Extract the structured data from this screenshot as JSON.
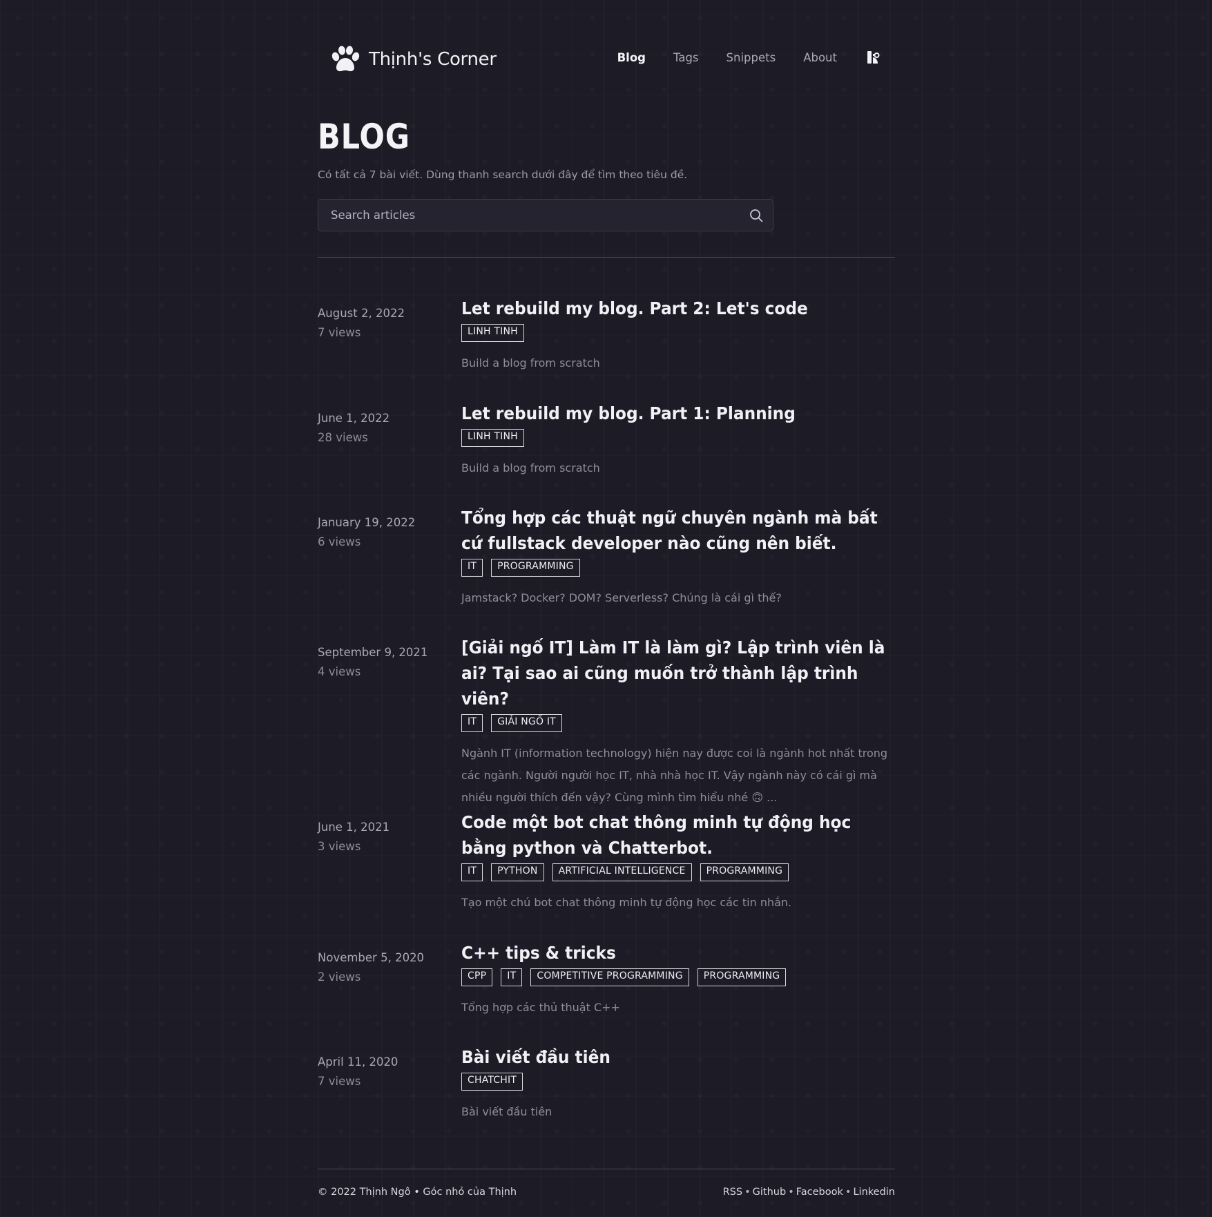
{
  "brand": {
    "name": "Thịnh's Corner"
  },
  "nav": {
    "items": [
      {
        "label": "Blog",
        "active": true
      },
      {
        "label": "Tags",
        "active": false
      },
      {
        "label": "Snippets",
        "active": false
      },
      {
        "label": "About",
        "active": false
      }
    ],
    "theme_toggle_icon": "theme-toggle-icon"
  },
  "page": {
    "title": "BLOG",
    "subtitle": "Có tất cả 7 bài viết. Dùng thanh search dưới đây để tìm theo tiêu đề."
  },
  "search": {
    "placeholder": "Search articles",
    "value": ""
  },
  "posts": [
    {
      "date": "August 2, 2022",
      "views": "7 views",
      "title": "Let rebuild my blog. Part 2: Let's code",
      "tags": [
        "LINH TINH"
      ],
      "summary": "Build a blog from scratch"
    },
    {
      "date": "June 1, 2022",
      "views": "28 views",
      "title": "Let rebuild my blog. Part 1: Planning",
      "tags": [
        "LINH TINH"
      ],
      "summary": "Build a blog from scratch"
    },
    {
      "date": "January 19, 2022",
      "views": "6 views",
      "title": "Tổng hợp các thuật ngữ chuyên ngành mà bất cứ fullstack developer nào cũng nên biết.",
      "tags": [
        "IT",
        "PROGRAMMING"
      ],
      "summary": "Jamstack? Docker? DOM? Serverless? Chúng là cái gì thế?"
    },
    {
      "date": "September 9, 2021",
      "views": "4 views",
      "title": "[Giải ngố IT] Làm IT là làm gì? Lập trình viên là ai? Tại sao ai cũng muốn trở thành lập trình viên?",
      "tags": [
        "IT",
        "GIẢI NGỐ IT"
      ],
      "summary": "Ngành IT (information technology) hiện nay được coi là ngành hot nhất trong các ngành. Người người học IT, nhà nhà học IT. Vậy ngành này có cái gì mà nhiều người thích đến vậy? Cùng mình tìm hiểu nhé 🙃 ..."
    },
    {
      "date": "June 1, 2021",
      "views": "3 views",
      "title": "Code một bot chat thông minh tự động học bằng python và Chatterbot.",
      "tags": [
        "IT",
        "PYTHON",
        "ARTIFICIAL INTELLIGENCE",
        "PROGRAMMING"
      ],
      "summary": "Tạo một chú bot chat thông minh tự động học các tin nhắn."
    },
    {
      "date": "November 5, 2020",
      "views": "2 views",
      "title": "C++ tips & tricks",
      "tags": [
        "CPP",
        "IT",
        "COMPETITIVE PROGRAMMING",
        "PROGRAMMING"
      ],
      "summary": "Tổng hợp các thủ thuật C++"
    },
    {
      "date": "April 11, 2020",
      "views": "7 views",
      "title": "Bài viết đầu tiên",
      "tags": [
        "CHATCHIT"
      ],
      "summary": "Bài viết đầu tiên"
    }
  ],
  "footer": {
    "copyright": "© 2022 Thịnh Ngô • Góc nhỏ của Thịnh",
    "links": [
      "RSS",
      "Github",
      "Facebook",
      "Linkedin"
    ]
  }
}
